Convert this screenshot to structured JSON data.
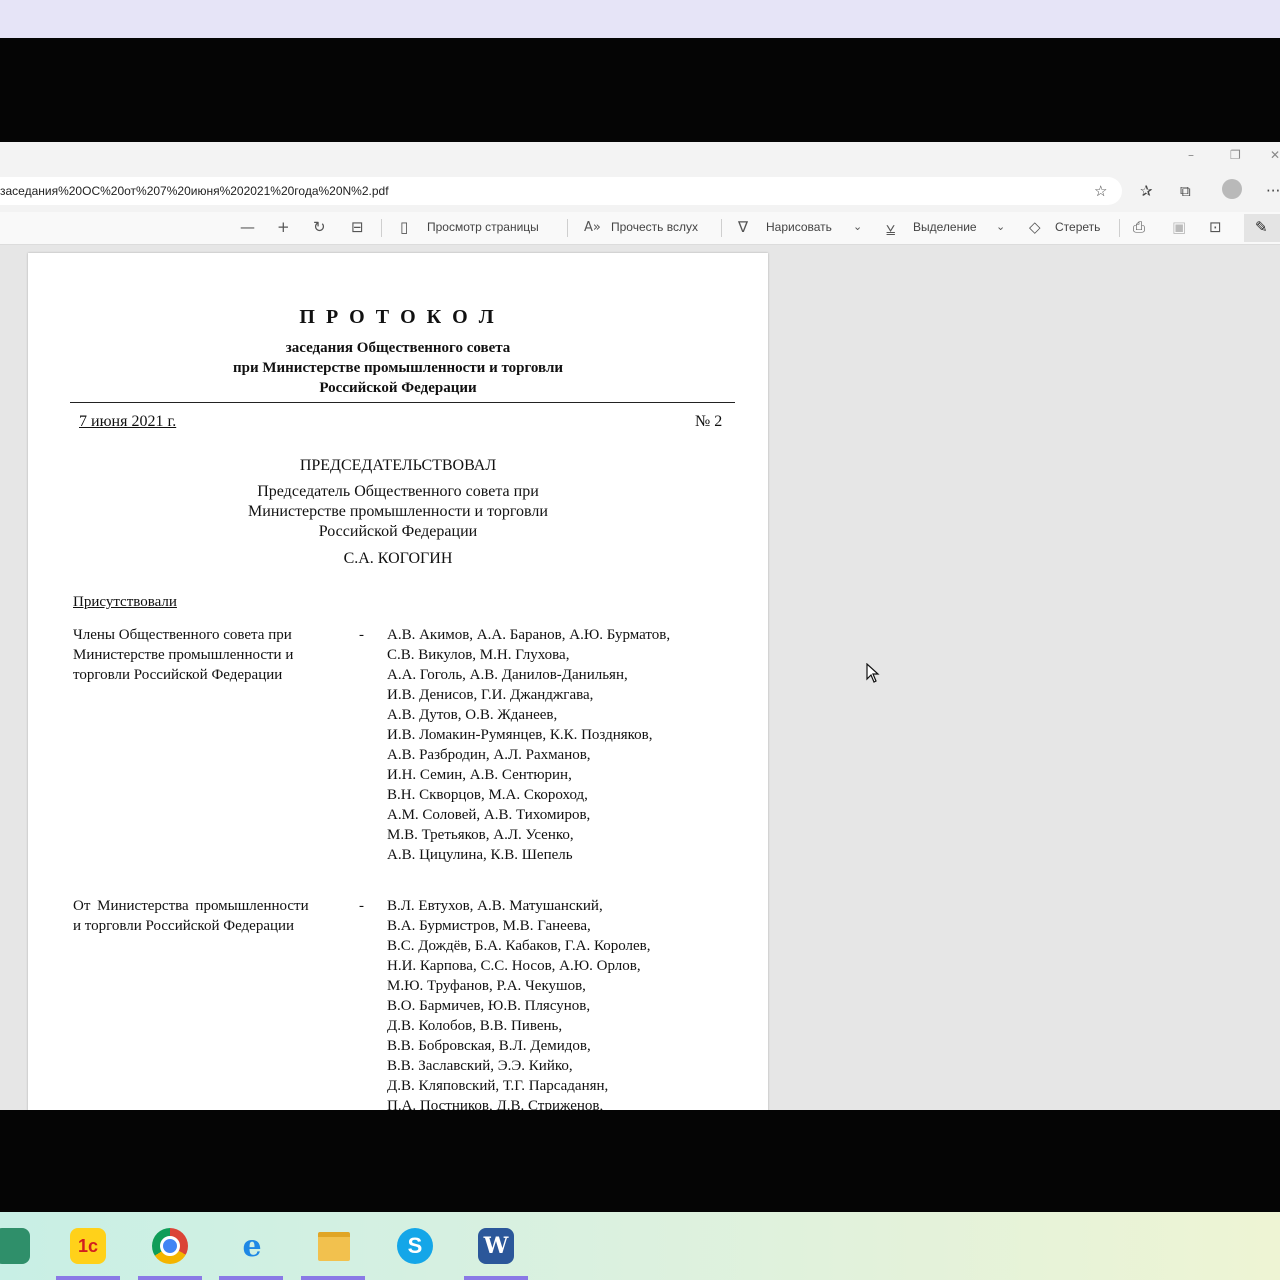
{
  "browser": {
    "url": "заседания%20ОС%20от%207%20июня%202021%20года%20N%2.pdf",
    "window_controls": [
      "–",
      "❐",
      "✕"
    ],
    "address_icons": [
      "favorite-add-icon",
      "favorites-icon",
      "collections-icon",
      "profile-avatar",
      "more-icon"
    ]
  },
  "pdf_toolbar": {
    "zoom_out": "—",
    "zoom_in": "+",
    "page_view": "Просмотр страницы",
    "read_aloud": "Прочесть вслух",
    "draw": "Нарисовать",
    "highlight": "Выделение",
    "erase": "Стереть"
  },
  "document": {
    "title": "П Р О Т О К О Л",
    "subtitle1": "заседания Общественного совета",
    "subtitle2": "при Министерстве промышленности и торговли",
    "subtitle3": "Российской Федерации",
    "date": "7 июня 2021 г.",
    "number": "№ 2",
    "chaired_heading": "ПРЕДСЕДАТЕЛЬСТВОВАЛ",
    "chair_line1": "Председатель Общественного совета при",
    "chair_line2": "Министерстве промышленности и торговли",
    "chair_line3": "Российской Федерации",
    "chair_name": "С.А. КОГОГИН",
    "present_label": "Присутствовали",
    "dash": "-",
    "members_label": [
      "Члены Общественного совета при",
      "Министерстве промышленности и",
      "торговли Российской Федерации"
    ],
    "members": [
      "А.В. Акимов, А.А. Баранов, А.Ю. Бурматов,",
      "С.В. Викулов, М.Н. Глухова,",
      "А.А. Гоголь, А.В. Данилов-Данильян,",
      "И.В. Денисов, Г.И. Джанджгава,",
      "А.В. Дутов, О.В. Жданеев,",
      "И.В. Ломакин-Румянцев, К.К. Поздняков,",
      "А.В. Разбродин, А.Л. Рахманов,",
      "И.Н. Семин, А.В. Сентюрин,",
      "В.Н. Скворцов, М.А. Скороход,",
      "А.М. Соловей, А.В. Тихомиров,",
      "М.В. Третьяков, А.Л. Усенко,",
      "А.В. Цицулина, К.В. Шепель"
    ],
    "ministry_label": [
      "От Министерства промышленности",
      "и торговли Российской Федерации"
    ],
    "ministry": [
      "В.Л. Евтухов, А.В. Матушанский,",
      "В.А. Бурмистров, М.В. Ганеева,",
      "В.С. Дождёв, Б.А. Кабаков, Г.А. Королев,",
      "Н.И. Карпова, С.С. Носов, А.Ю. Орлов,",
      "М.Ю. Труфанов, Р.А. Чекушов,",
      "В.О. Бармичев, Ю.В. Плясунов,",
      "Д.В. Колобов, В.В. Пивень,",
      "В.В. Бобровская, В.Л. Демидов,",
      "В.В. Заславский, Э.Э. Кийко,",
      "Д.В. Кляповский, Т.Г. Парсаданян,",
      "П.А. Постников, Д.В. Стриженов,"
    ]
  },
  "taskbar": {
    "apps": [
      {
        "name": "1C-launcher-icon",
        "label": ""
      },
      {
        "name": "1c-enterprise-icon",
        "label": "1с"
      },
      {
        "name": "chrome-icon",
        "label": ""
      },
      {
        "name": "internet-explorer-icon",
        "label": "e"
      },
      {
        "name": "file-explorer-icon",
        "label": ""
      },
      {
        "name": "skype-icon",
        "label": "S"
      },
      {
        "name": "word-icon",
        "label": "W"
      }
    ]
  }
}
